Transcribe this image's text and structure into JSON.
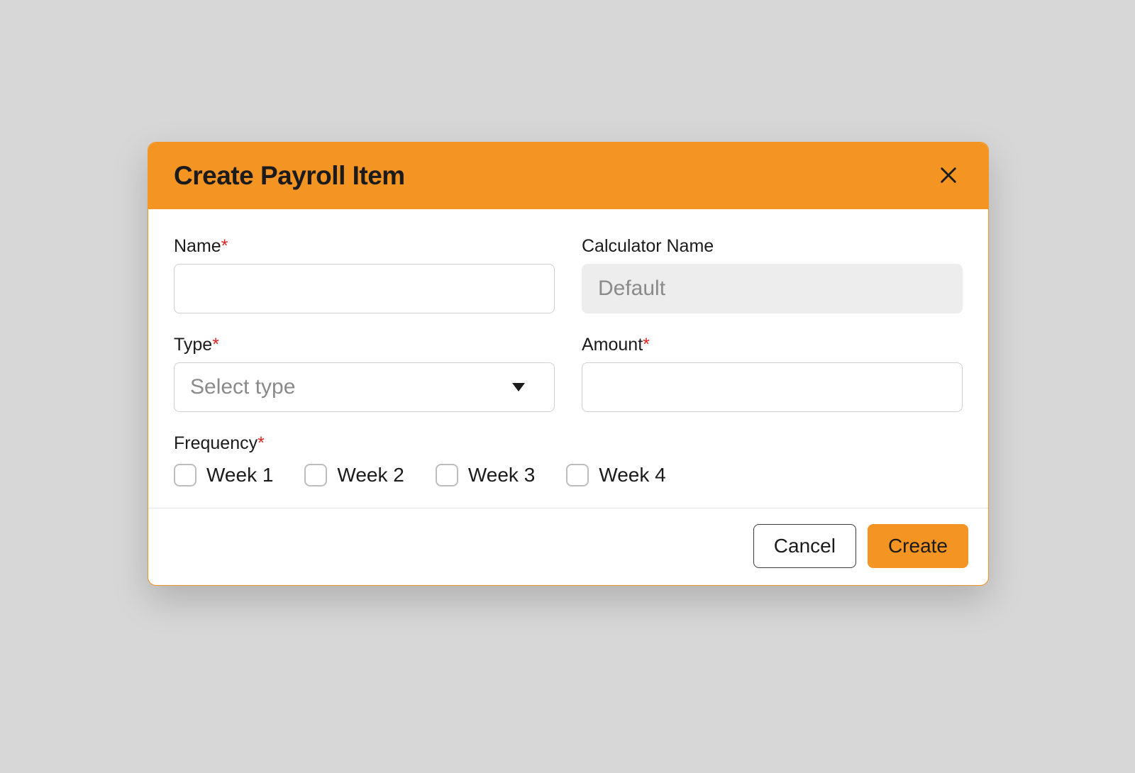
{
  "colors": {
    "accent": "#F39423",
    "required": "#E02424"
  },
  "modal": {
    "title": "Create Payroll Item"
  },
  "fields": {
    "name": {
      "label": "Name",
      "value": ""
    },
    "calculator": {
      "label": "Calculator Name",
      "value": "Default"
    },
    "type": {
      "label": "Type",
      "placeholder": "Select type"
    },
    "amount": {
      "label": "Amount",
      "value": ""
    },
    "frequency": {
      "label": "Frequency",
      "options": [
        "Week 1",
        "Week 2",
        "Week 3",
        "Week 4"
      ]
    }
  },
  "footer": {
    "cancel": "Cancel",
    "create": "Create"
  },
  "required_marker": "*"
}
